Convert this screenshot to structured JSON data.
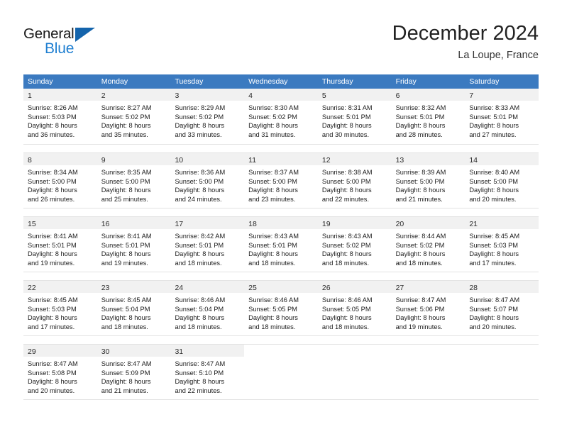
{
  "brand": {
    "name_dark": "General",
    "name_light": "Blue",
    "triangle_color": "#1464ac",
    "blue_color": "#1f7fd1"
  },
  "header": {
    "title": "December 2024",
    "subtitle": "La Loupe, France"
  },
  "theme": {
    "header_bg": "#3b7ac0",
    "header_text": "#ffffff",
    "daynum_bg": "#f1f1f1",
    "cell_bg": "#ffffff",
    "grid_line": "#e3e3e3"
  },
  "weekdays": [
    "Sunday",
    "Monday",
    "Tuesday",
    "Wednesday",
    "Thursday",
    "Friday",
    "Saturday"
  ],
  "weeks": [
    [
      {
        "day": "1",
        "sunrise": "Sunrise: 8:26 AM",
        "sunset": "Sunset: 5:03 PM",
        "daylight1": "Daylight: 8 hours",
        "daylight2": "and 36 minutes."
      },
      {
        "day": "2",
        "sunrise": "Sunrise: 8:27 AM",
        "sunset": "Sunset: 5:02 PM",
        "daylight1": "Daylight: 8 hours",
        "daylight2": "and 35 minutes."
      },
      {
        "day": "3",
        "sunrise": "Sunrise: 8:29 AM",
        "sunset": "Sunset: 5:02 PM",
        "daylight1": "Daylight: 8 hours",
        "daylight2": "and 33 minutes."
      },
      {
        "day": "4",
        "sunrise": "Sunrise: 8:30 AM",
        "sunset": "Sunset: 5:02 PM",
        "daylight1": "Daylight: 8 hours",
        "daylight2": "and 31 minutes."
      },
      {
        "day": "5",
        "sunrise": "Sunrise: 8:31 AM",
        "sunset": "Sunset: 5:01 PM",
        "daylight1": "Daylight: 8 hours",
        "daylight2": "and 30 minutes."
      },
      {
        "day": "6",
        "sunrise": "Sunrise: 8:32 AM",
        "sunset": "Sunset: 5:01 PM",
        "daylight1": "Daylight: 8 hours",
        "daylight2": "and 28 minutes."
      },
      {
        "day": "7",
        "sunrise": "Sunrise: 8:33 AM",
        "sunset": "Sunset: 5:01 PM",
        "daylight1": "Daylight: 8 hours",
        "daylight2": "and 27 minutes."
      }
    ],
    [
      {
        "day": "8",
        "sunrise": "Sunrise: 8:34 AM",
        "sunset": "Sunset: 5:00 PM",
        "daylight1": "Daylight: 8 hours",
        "daylight2": "and 26 minutes."
      },
      {
        "day": "9",
        "sunrise": "Sunrise: 8:35 AM",
        "sunset": "Sunset: 5:00 PM",
        "daylight1": "Daylight: 8 hours",
        "daylight2": "and 25 minutes."
      },
      {
        "day": "10",
        "sunrise": "Sunrise: 8:36 AM",
        "sunset": "Sunset: 5:00 PM",
        "daylight1": "Daylight: 8 hours",
        "daylight2": "and 24 minutes."
      },
      {
        "day": "11",
        "sunrise": "Sunrise: 8:37 AM",
        "sunset": "Sunset: 5:00 PM",
        "daylight1": "Daylight: 8 hours",
        "daylight2": "and 23 minutes."
      },
      {
        "day": "12",
        "sunrise": "Sunrise: 8:38 AM",
        "sunset": "Sunset: 5:00 PM",
        "daylight1": "Daylight: 8 hours",
        "daylight2": "and 22 minutes."
      },
      {
        "day": "13",
        "sunrise": "Sunrise: 8:39 AM",
        "sunset": "Sunset: 5:00 PM",
        "daylight1": "Daylight: 8 hours",
        "daylight2": "and 21 minutes."
      },
      {
        "day": "14",
        "sunrise": "Sunrise: 8:40 AM",
        "sunset": "Sunset: 5:00 PM",
        "daylight1": "Daylight: 8 hours",
        "daylight2": "and 20 minutes."
      }
    ],
    [
      {
        "day": "15",
        "sunrise": "Sunrise: 8:41 AM",
        "sunset": "Sunset: 5:01 PM",
        "daylight1": "Daylight: 8 hours",
        "daylight2": "and 19 minutes."
      },
      {
        "day": "16",
        "sunrise": "Sunrise: 8:41 AM",
        "sunset": "Sunset: 5:01 PM",
        "daylight1": "Daylight: 8 hours",
        "daylight2": "and 19 minutes."
      },
      {
        "day": "17",
        "sunrise": "Sunrise: 8:42 AM",
        "sunset": "Sunset: 5:01 PM",
        "daylight1": "Daylight: 8 hours",
        "daylight2": "and 18 minutes."
      },
      {
        "day": "18",
        "sunrise": "Sunrise: 8:43 AM",
        "sunset": "Sunset: 5:01 PM",
        "daylight1": "Daylight: 8 hours",
        "daylight2": "and 18 minutes."
      },
      {
        "day": "19",
        "sunrise": "Sunrise: 8:43 AM",
        "sunset": "Sunset: 5:02 PM",
        "daylight1": "Daylight: 8 hours",
        "daylight2": "and 18 minutes."
      },
      {
        "day": "20",
        "sunrise": "Sunrise: 8:44 AM",
        "sunset": "Sunset: 5:02 PM",
        "daylight1": "Daylight: 8 hours",
        "daylight2": "and 18 minutes."
      },
      {
        "day": "21",
        "sunrise": "Sunrise: 8:45 AM",
        "sunset": "Sunset: 5:03 PM",
        "daylight1": "Daylight: 8 hours",
        "daylight2": "and 17 minutes."
      }
    ],
    [
      {
        "day": "22",
        "sunrise": "Sunrise: 8:45 AM",
        "sunset": "Sunset: 5:03 PM",
        "daylight1": "Daylight: 8 hours",
        "daylight2": "and 17 minutes."
      },
      {
        "day": "23",
        "sunrise": "Sunrise: 8:45 AM",
        "sunset": "Sunset: 5:04 PM",
        "daylight1": "Daylight: 8 hours",
        "daylight2": "and 18 minutes."
      },
      {
        "day": "24",
        "sunrise": "Sunrise: 8:46 AM",
        "sunset": "Sunset: 5:04 PM",
        "daylight1": "Daylight: 8 hours",
        "daylight2": "and 18 minutes."
      },
      {
        "day": "25",
        "sunrise": "Sunrise: 8:46 AM",
        "sunset": "Sunset: 5:05 PM",
        "daylight1": "Daylight: 8 hours",
        "daylight2": "and 18 minutes."
      },
      {
        "day": "26",
        "sunrise": "Sunrise: 8:46 AM",
        "sunset": "Sunset: 5:05 PM",
        "daylight1": "Daylight: 8 hours",
        "daylight2": "and 18 minutes."
      },
      {
        "day": "27",
        "sunrise": "Sunrise: 8:47 AM",
        "sunset": "Sunset: 5:06 PM",
        "daylight1": "Daylight: 8 hours",
        "daylight2": "and 19 minutes."
      },
      {
        "day": "28",
        "sunrise": "Sunrise: 8:47 AM",
        "sunset": "Sunset: 5:07 PM",
        "daylight1": "Daylight: 8 hours",
        "daylight2": "and 20 minutes."
      }
    ],
    [
      {
        "day": "29",
        "sunrise": "Sunrise: 8:47 AM",
        "sunset": "Sunset: 5:08 PM",
        "daylight1": "Daylight: 8 hours",
        "daylight2": "and 20 minutes."
      },
      {
        "day": "30",
        "sunrise": "Sunrise: 8:47 AM",
        "sunset": "Sunset: 5:09 PM",
        "daylight1": "Daylight: 8 hours",
        "daylight2": "and 21 minutes."
      },
      {
        "day": "31",
        "sunrise": "Sunrise: 8:47 AM",
        "sunset": "Sunset: 5:10 PM",
        "daylight1": "Daylight: 8 hours",
        "daylight2": "and 22 minutes."
      },
      {
        "day": "",
        "sunrise": "",
        "sunset": "",
        "daylight1": "",
        "daylight2": ""
      },
      {
        "day": "",
        "sunrise": "",
        "sunset": "",
        "daylight1": "",
        "daylight2": ""
      },
      {
        "day": "",
        "sunrise": "",
        "sunset": "",
        "daylight1": "",
        "daylight2": ""
      },
      {
        "day": "",
        "sunrise": "",
        "sunset": "",
        "daylight1": "",
        "daylight2": ""
      }
    ]
  ]
}
